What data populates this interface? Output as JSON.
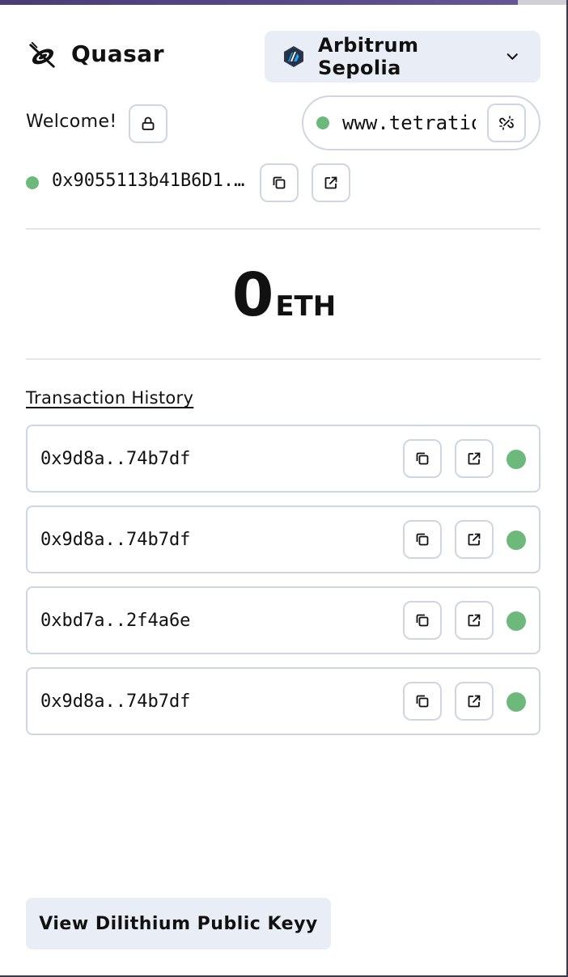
{
  "header": {
    "brand": "Quasar",
    "network": {
      "label": "Arbitrum Sepolia",
      "icon": "arbitrum-icon"
    }
  },
  "session": {
    "welcome": "Welcome!",
    "site": "www.tetratio",
    "site_status_color": "#6db97c"
  },
  "account": {
    "address": "0x9055113b41B6D1...",
    "status_color": "#6db97c"
  },
  "balance": {
    "value": "0",
    "unit": "ETH"
  },
  "history": {
    "title": "Transaction History",
    "transactions": [
      {
        "hash": "0x9d8a..74b7df",
        "status": "success"
      },
      {
        "hash": "0x9d8a..74b7df",
        "status": "success"
      },
      {
        "hash": "0xbd7a..2f4a6e",
        "status": "success"
      },
      {
        "hash": "0x9d8a..74b7df",
        "status": "success"
      }
    ]
  },
  "footer": {
    "key_button": "View Dilithium Public Keyy"
  },
  "colors": {
    "accent_bg": "#e9edf5",
    "border": "#cfd6e3",
    "success": "#6db97c"
  }
}
